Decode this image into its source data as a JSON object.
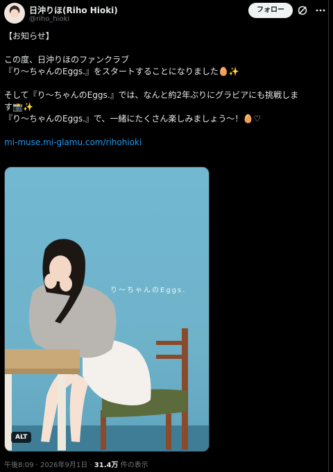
{
  "author": {
    "display_name": "日沖りほ(Riho Hioki)",
    "handle": "@riho_hioki"
  },
  "header": {
    "follow_label": "フォロー",
    "grok_icon": "grok-icon",
    "more_icon": "more-icon"
  },
  "tweet": {
    "lines": [
      "【お知らせ】",
      "",
      "この度、日沖りほのファンクラブ",
      "『り〜ちゃんのEggs.』をスタートすることになりました🥚✨",
      "",
      "そして『り〜ちゃんのEggs.』では、なんと約2年ぶりにグラビアにも挑戦しま",
      "す📸✨",
      "『り〜ちゃんのEggs.』で、一緒にたくさん楽しみましょう〜！🥚♡",
      ""
    ],
    "link": "mi-muse.mi-glamu.com/rihohioki"
  },
  "media": {
    "overlay_text": "り〜ちゃんのEggs.",
    "alt_label": "ALT"
  },
  "meta": {
    "time": "午後8:09",
    "separator": "·",
    "date": "2026年9月1日",
    "views_count": "31.4万",
    "views_label": "件の表示"
  },
  "colors": {
    "background": "#000000",
    "text": "#e7e9ea",
    "secondary": "#71767b",
    "link": "#1d9bf0",
    "photo_wall": "#6fb3cb"
  }
}
